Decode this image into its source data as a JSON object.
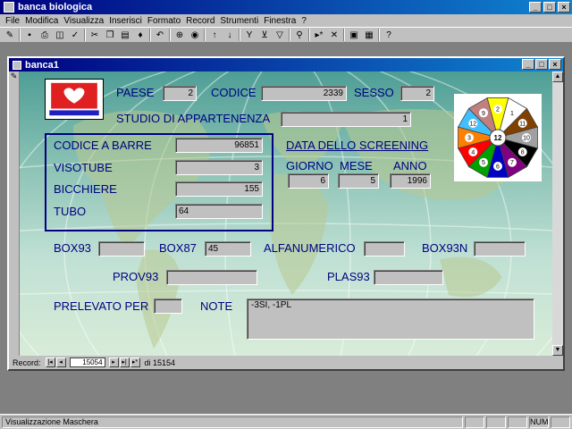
{
  "app": {
    "title": "banca biologica"
  },
  "menu": [
    "File",
    "Modifica",
    "Visualizza",
    "Inserisci",
    "Formato",
    "Record",
    "Strumenti",
    "Finestra",
    "?"
  ],
  "child": {
    "title": "banca1"
  },
  "form": {
    "paese": {
      "label": "PAESE",
      "value": "2"
    },
    "codice": {
      "label": "CODICE",
      "value": "2339"
    },
    "sesso": {
      "label": "SESSO",
      "value": "2"
    },
    "studio": {
      "label": "STUDIO DI APPARTENENZA",
      "value": "1"
    },
    "codice_barre": {
      "label": "CODICE A BARRE",
      "value": "96851"
    },
    "visotube": {
      "label": "VISOTUBE",
      "value": "3"
    },
    "bicchiere": {
      "label": "BICCHIERE",
      "value": "155"
    },
    "tubo": {
      "label": "TUBO",
      "value": "64"
    },
    "screening": {
      "label": "DATA DELLO SCREENING"
    },
    "giorno": {
      "label": "GIORNO",
      "value": "6"
    },
    "mese": {
      "label": "MESE",
      "value": "5"
    },
    "anno": {
      "label": "ANNO",
      "value": "1996"
    },
    "box93": {
      "label": "BOX93",
      "value": ""
    },
    "box87": {
      "label": "BOX87",
      "value": "45"
    },
    "alfanumerico": {
      "label": "ALFANUMERICO",
      "value": ""
    },
    "box93n": {
      "label": "BOX93N",
      "value": ""
    },
    "prov93": {
      "label": "PROV93",
      "value": ""
    },
    "plas93": {
      "label": "PLAS93",
      "value": ""
    },
    "prelevato": {
      "label": "PRELEVATO PER",
      "value": ""
    },
    "note": {
      "label": "NOTE",
      "value": "-3SI, -1PL"
    }
  },
  "wheel": {
    "numbers": [
      "1",
      "2",
      "3",
      "4",
      "5",
      "6",
      "7",
      "8",
      "9",
      "10",
      "11",
      "12"
    ],
    "colors": [
      "#ffffff",
      "#ffff00",
      "#ff8000",
      "#ff0000",
      "#00a000",
      "#0000c0",
      "#800080",
      "#000000",
      "#c08080",
      "#a0a0a0",
      "#804000",
      "#40c0ff"
    ]
  },
  "navbar": {
    "label": "Record:",
    "current": "15054",
    "total": "di 15154"
  },
  "status": {
    "text": "Visualizzazione Maschera",
    "num": "NUM"
  },
  "colors": {
    "accent": "#000080",
    "title_start": "#000080",
    "title_end": "#1084d0"
  }
}
